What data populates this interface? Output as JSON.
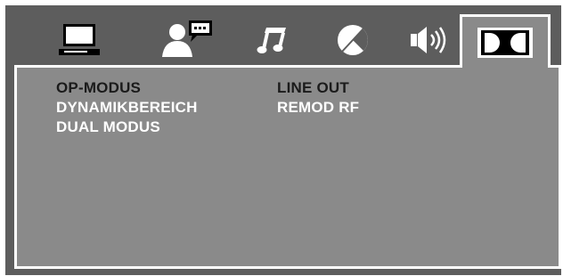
{
  "tabs": [
    {
      "id": "general",
      "icon": "monitor-icon"
    },
    {
      "id": "language",
      "icon": "person-speech-icon"
    },
    {
      "id": "audio",
      "icon": "music-note-icon"
    },
    {
      "id": "video",
      "icon": "contrast-circle-icon"
    },
    {
      "id": "speaker",
      "icon": "speaker-icon"
    },
    {
      "id": "dolby",
      "icon": "dolby-icon",
      "active": true
    }
  ],
  "menu": {
    "left": [
      {
        "label": "OP-MODUS",
        "selected": true
      },
      {
        "label": "DYNAMIKBEREICH",
        "selected": false
      },
      {
        "label": "DUAL MODUS",
        "selected": false
      }
    ],
    "right": [
      {
        "label": "LINE OUT",
        "selected": true
      },
      {
        "label": "REMOD RF",
        "selected": false
      }
    ]
  },
  "colors": {
    "background": "#5d5d5d",
    "panel": "#8a8a8a",
    "border": "#ffffff",
    "selected_text": "#1b1b1b",
    "text": "#ffffff"
  }
}
